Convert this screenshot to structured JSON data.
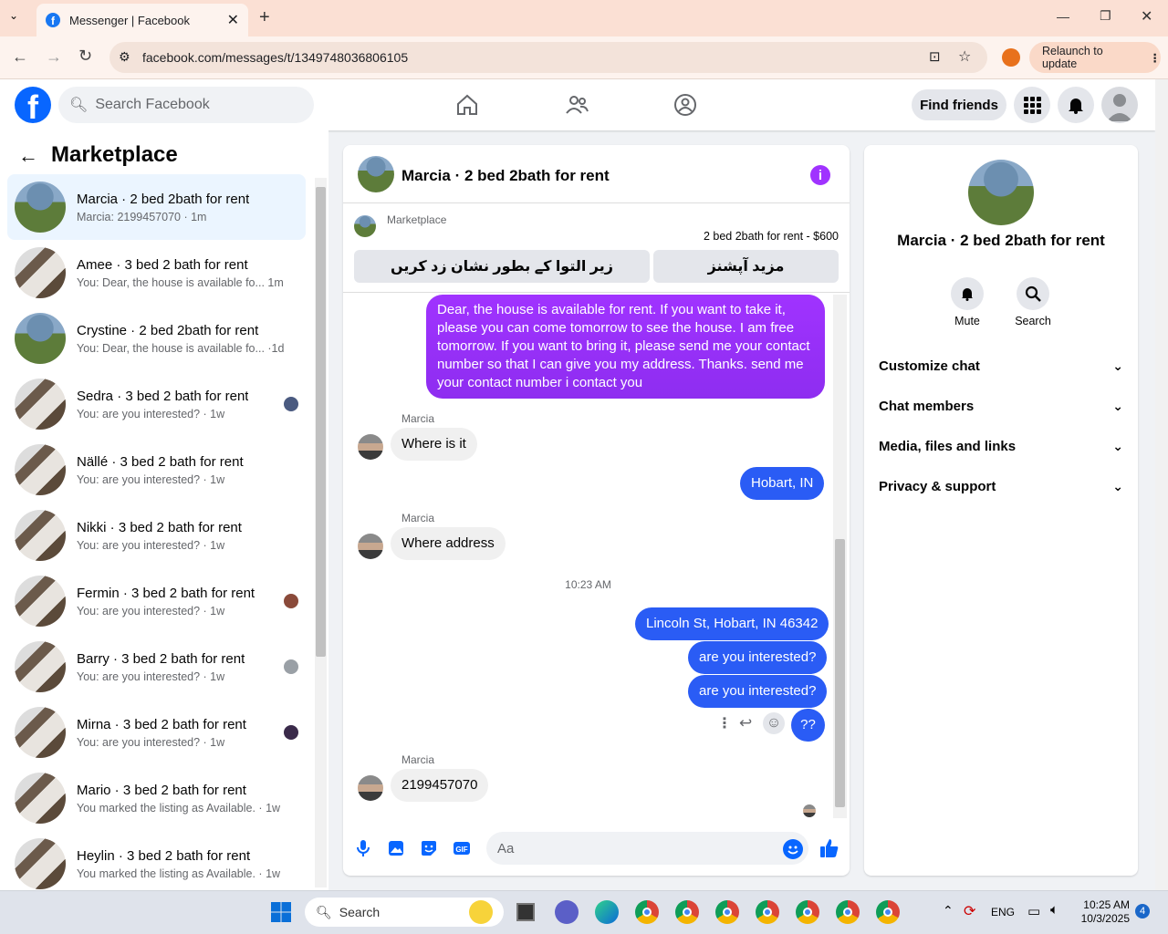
{
  "browser": {
    "tab_title": "Messenger | Facebook",
    "url": "facebook.com/messages/t/1349748036806105",
    "relaunch": "Relaunch to update"
  },
  "fb": {
    "logo": "f",
    "search_placeholder": "Search Facebook",
    "find_friends": "Find friends"
  },
  "left": {
    "title": "Marketplace",
    "items": [
      {
        "name": "Marcia · 2 bed 2bath for rent",
        "sub": "Marcia: 2199457070 · 1m",
        "avatar": "house"
      },
      {
        "name": "Amee · 3 bed 2 bath for rent",
        "sub": "You: Dear, the house is available fo... 1m",
        "avatar": "room"
      },
      {
        "name": "Crystine · 2 bed 2bath for rent",
        "sub": "You: Dear, the house is available fo... ·1d",
        "avatar": "house"
      },
      {
        "name": "Sedra · 3 bed 2 bath for rent",
        "sub": "You: are you interested? · 1w",
        "avatar": "room"
      },
      {
        "name": "Nällé · 3 bed 2 bath for rent",
        "sub": "You: are you interested? · 1w",
        "avatar": "room"
      },
      {
        "name": "Nikki · 3 bed 2 bath for rent",
        "sub": "You: are you interested? · 1w",
        "avatar": "room"
      },
      {
        "name": "Fermin · 3 bed 2 bath for rent",
        "sub": "You: are you interested? · 1w",
        "avatar": "room"
      },
      {
        "name": "Barry · 3 bed 2 bath for rent",
        "sub": "You: are you interested? · 1w",
        "avatar": "room"
      },
      {
        "name": "Mirna · 3 bed 2 bath for rent",
        "sub": "You: are you interested? · 1w",
        "avatar": "room"
      },
      {
        "name": "Mario · 3 bed 2 bath for rent",
        "sub": "You marked the listing as Available. · 1w",
        "avatar": "room"
      },
      {
        "name": "Heylin · 3 bed 2 bath for rent",
        "sub": "You marked the listing as Available. · 1w",
        "avatar": "room"
      }
    ]
  },
  "chat": {
    "title": "Marcia · 2 bed 2bath for rent",
    "marketplace_label": "Marketplace",
    "listing": "2 bed 2bath for rent - $600",
    "btn_left": "زیر التوا کے بطور نشان زد کریں",
    "btn_right": "مزید آپشنز",
    "msg1": "Dear, the house is available for rent. If you want to take it, please you can come tomorrow to see the house. I am free tomorrow. If you want to bring it, please send me your contact number so that I can give you my address. Thanks. send me your contact number   i contact you",
    "sender": "Marcia",
    "msg2": "Where is it",
    "msg3": "Hobart, IN",
    "msg4": "Where address",
    "time": "10:23 AM",
    "msg5": "Lincoln St, Hobart, IN 46342",
    "msg6": "are you interested?",
    "msg7": "are you interested?",
    "msg8": "??",
    "msg9": "2199457070",
    "composer_placeholder": "Aa"
  },
  "right": {
    "name": "Marcia · 2 bed 2bath for rent",
    "mute": "Mute",
    "search": "Search",
    "rows": [
      "Customize chat",
      "Chat members",
      "Media, files and links",
      "Privacy & support"
    ]
  },
  "taskbar": {
    "search": "Search",
    "lang": "ENG",
    "time": "10:25 AM",
    "date": "10/3/2025",
    "badge": "4"
  }
}
